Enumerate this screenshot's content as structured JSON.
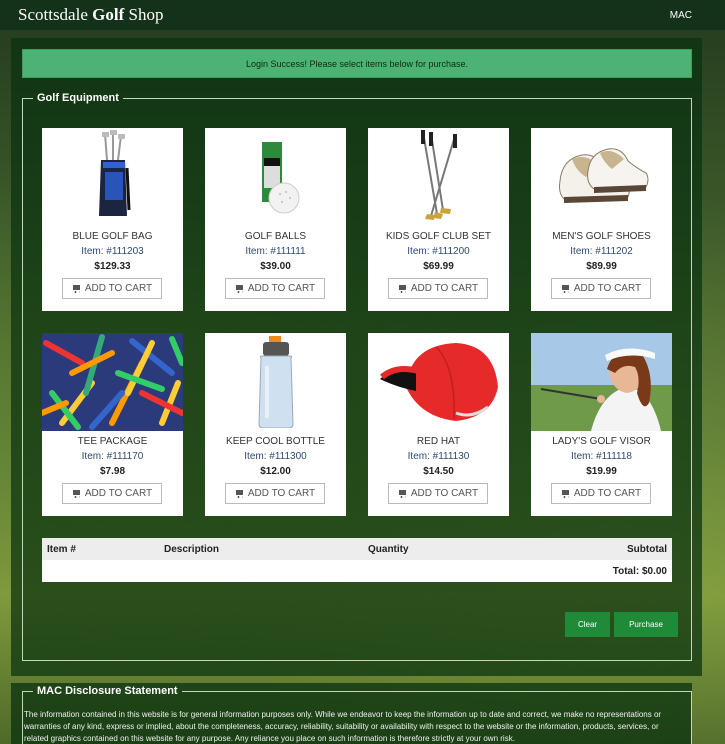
{
  "navbar": {
    "brand_plain": "Scottsdale ",
    "brand_bold": "Golf",
    "brand_tail": " Shop",
    "right_link": "MAC"
  },
  "alert": {
    "message": "Login Success! Please select items below for purchase."
  },
  "equipment": {
    "legend": "Golf Equipment",
    "add_label": "ADD TO CART",
    "products": [
      {
        "name": "BLUE GOLF BAG",
        "item": "Item: #111203",
        "price": "$129.33",
        "icon": "golf-bag-icon"
      },
      {
        "name": "GOLF BALLS",
        "item": "Item: #111111",
        "price": "$39.00",
        "icon": "golf-balls-icon"
      },
      {
        "name": "KIDS GOLF CLUB SET",
        "item": "Item: #111200",
        "price": "$69.99",
        "icon": "golf-clubs-icon"
      },
      {
        "name": "MEN'S GOLF SHOES",
        "item": "Item: #111202",
        "price": "$89.99",
        "icon": "golf-shoes-icon"
      },
      {
        "name": "TEE PACKAGE",
        "item": "Item: #111170",
        "price": "$7.98",
        "icon": "tees-icon"
      },
      {
        "name": "KEEP COOL BOTTLE",
        "item": "Item: #111300",
        "price": "$12.00",
        "icon": "bottle-icon"
      },
      {
        "name": "RED HAT",
        "item": "Item: #111130",
        "price": "$14.50",
        "icon": "cap-icon"
      },
      {
        "name": "LADY'S GOLF VISOR",
        "item": "Item: #111118",
        "price": "$19.99",
        "icon": "visor-photo-icon"
      }
    ]
  },
  "cart": {
    "col_item": "Item #",
    "col_description": "Description",
    "col_quantity": "Quantity",
    "col_subtotal": "Subtotal",
    "total": "Total: $0.00",
    "clear_label": "Clear",
    "purchase_label": "Purchase"
  },
  "disclosure": {
    "legend": "MAC Disclosure Statement",
    "text": "The information contained in this website is for general information purposes only. While we endeavor to keep the information up to date and correct, we make no representations or warranties of any kind, express or implied, about the completeness, accuracy, reliability, suitability or availability with respect to the website or the information, products, services, or related graphics contained on this website for any purpose. Any reliance you place on such information is therefore strictly at your own risk."
  }
}
